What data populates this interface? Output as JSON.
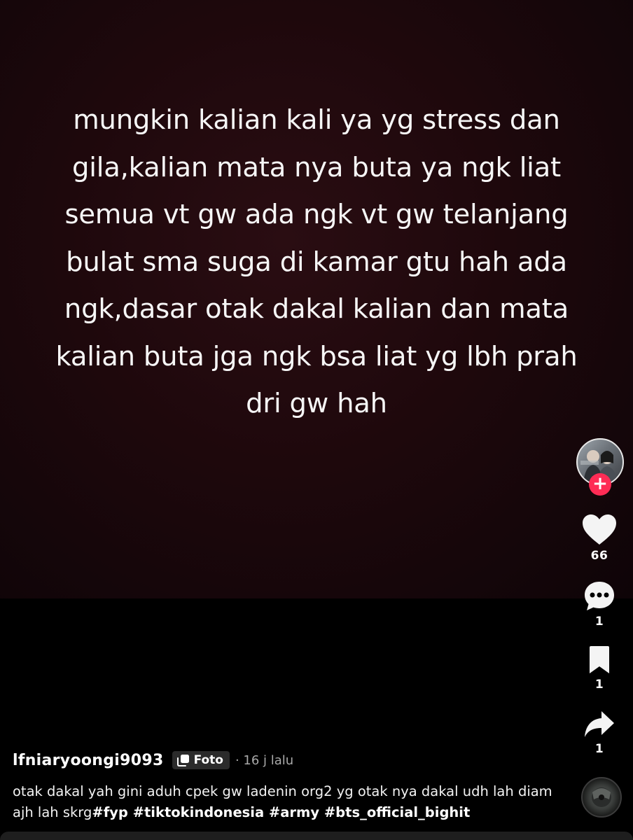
{
  "post": {
    "text": "mungkin kalian kali ya yg stress dan\ngila,kalian mata nya buta ya ngk liat\nsemua vt gw ada ngk vt gw telanjang\nbulat sma suga di kamar gtu hah ada\nngk,dasar otak dakal kalian dan mata\nkalian buta jga ngk bsa liat yg lbh prah\ndri gw hah"
  },
  "actions": {
    "likes": "66",
    "comments": "1",
    "bookmarks": "1",
    "shares": "1"
  },
  "author": {
    "username": "lfniaryoongi9093",
    "type_badge": "Foto",
    "time": "· 16 j lalu"
  },
  "caption": {
    "text": "otak dakal yah gini aduh cpek gw ladenin org2 yg otak nya dakal udh lah diam ajh lah skrg",
    "hashtags": "#fyp #tiktokindonesia #army #bts_official_bighit"
  },
  "colors": {
    "background": "#000000",
    "photo_background": "#1e080c",
    "follow_accent": "#fe2c55",
    "secondary_text": "#a9a9a9"
  },
  "icons": [
    "follow-plus-icon",
    "heart-icon",
    "comment-icon",
    "bookmark-icon",
    "share-icon",
    "photo-tag-icon",
    "music-disc-icon"
  ]
}
